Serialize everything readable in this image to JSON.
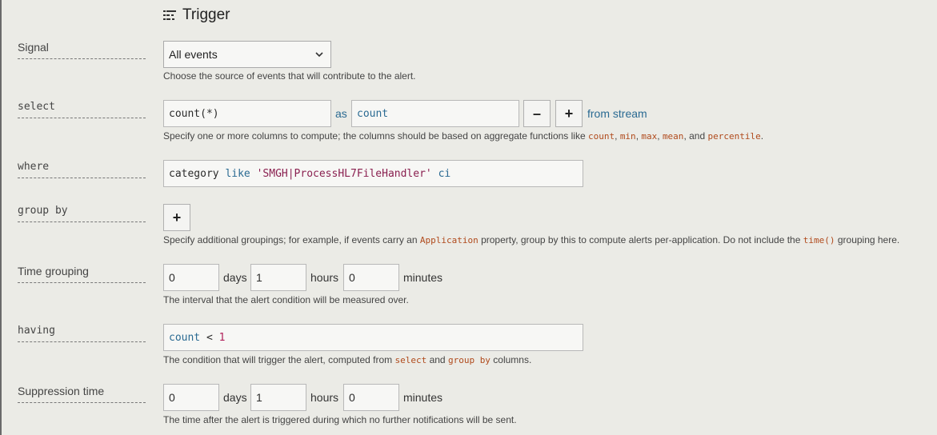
{
  "section": {
    "title": "Trigger",
    "icon": "filter-list-icon"
  },
  "signal": {
    "label": "Signal",
    "selected": "All events",
    "help": "Choose the source of events that will contribute to the alert."
  },
  "select": {
    "label": "select",
    "expression": "count(*)",
    "as_label": "as",
    "alias": "count",
    "remove_label": "–",
    "add_label": "+",
    "from_label": "from stream",
    "help_prefix": "Specify one or more columns to compute; the columns should be based on aggregate functions like",
    "funcs": [
      "count",
      "min",
      "max",
      "mean",
      "percentile"
    ],
    "sep1": ",",
    "sep2": ",",
    "sep3": ",",
    "sep4": ", and",
    "help_suffix": "."
  },
  "where": {
    "label": "where",
    "kw1": "category",
    "op": "like",
    "str": "'SMGH|ProcessHL7FileHandler'",
    "flag": "ci"
  },
  "group_by": {
    "label": "group by",
    "add_label": "+",
    "help_prefix": "Specify additional groupings; for example, if events carry an",
    "help_code1": "Application",
    "help_mid": "property, group by this to compute alerts per-application. Do not include the",
    "help_code2": "time()",
    "help_suffix": "grouping here."
  },
  "time_grouping": {
    "label": "Time grouping",
    "days": "0",
    "days_label": "days",
    "hours": "1",
    "hours_label": "hours",
    "minutes": "0",
    "minutes_label": "minutes",
    "help": "The interval that the alert condition will be measured over."
  },
  "having": {
    "label": "having",
    "lhs": "count",
    "op": "<",
    "rhs": "1",
    "help_prefix": "The condition that will trigger the alert, computed from",
    "help_code1": "select",
    "help_and": "and",
    "help_code2": "group by",
    "help_suffix": "columns."
  },
  "suppression": {
    "label": "Suppression time",
    "days": "0",
    "days_label": "days",
    "hours": "1",
    "hours_label": "hours",
    "minutes": "0",
    "minutes_label": "minutes",
    "help": "The time after the alert is triggered during which no further notifications will be sent."
  }
}
